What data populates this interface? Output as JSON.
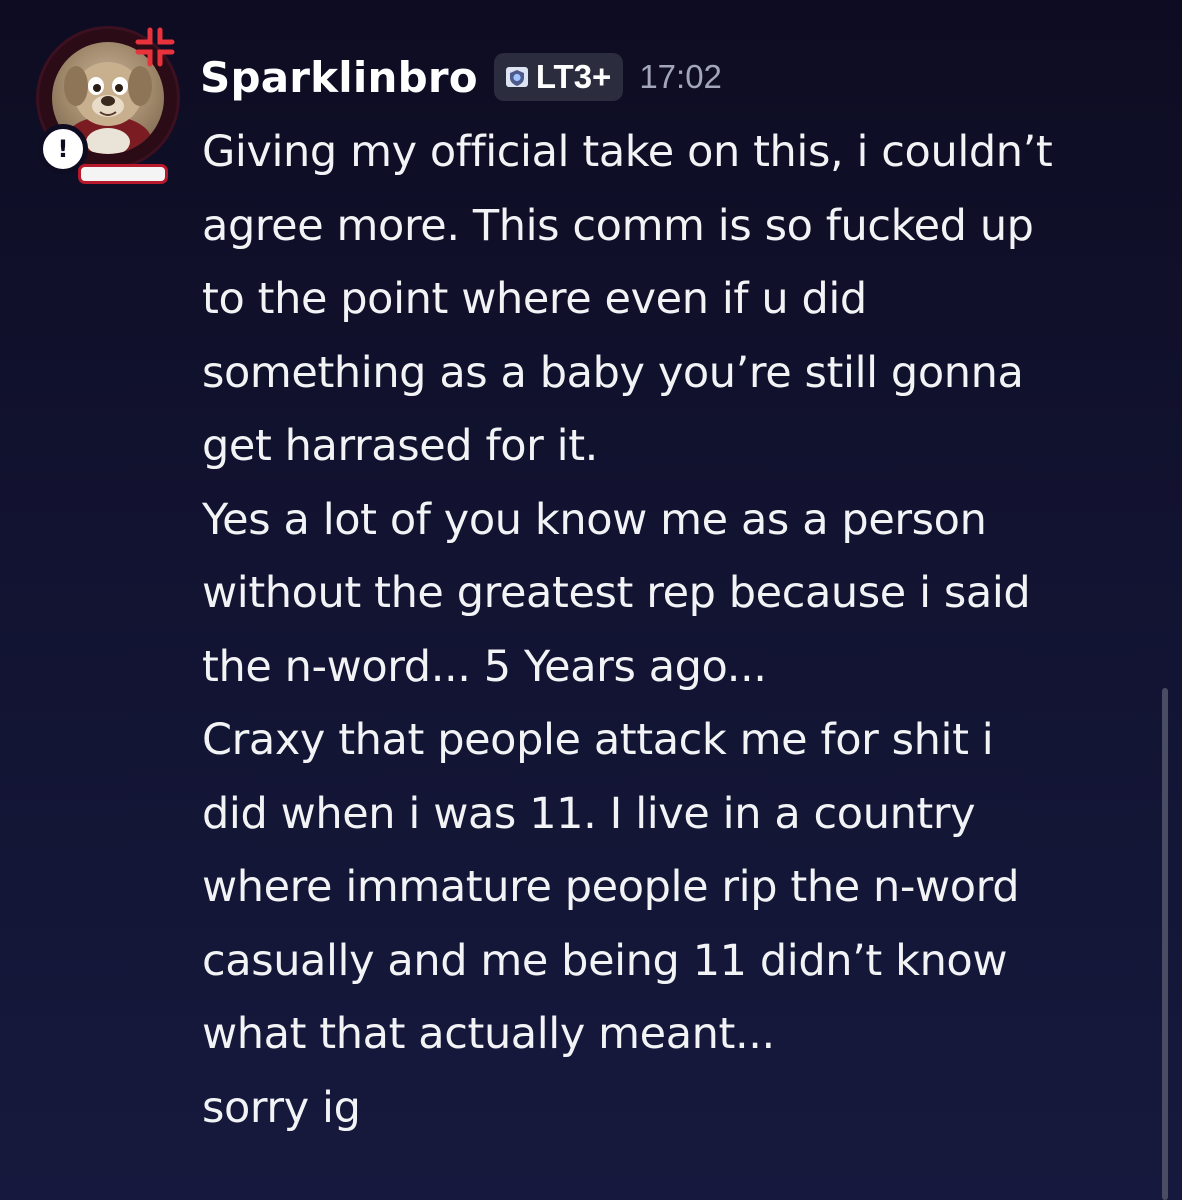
{
  "message": {
    "username": "Sparklinbro",
    "tag": {
      "label": "LT3+",
      "icon": "shield-badge-icon"
    },
    "timestamp": "17:02",
    "avatar": {
      "status_badge": "!",
      "overlay_icon": "angry-anger-symbol-icon"
    },
    "lines": [
      "Giving my official take on this, i couldn’t",
      "agree more. This comm is so fucked up",
      "to the point where even if u did",
      "something as a baby you’re still gonna",
      "get harrased for it.",
      "Yes a lot of you know me as a person",
      "without the greatest rep because i said",
      "the n-word... 5 Years ago...",
      "Craxy that people attack me for shit i",
      "did when i was 11. I live in a country",
      "where immature people rip the n-word",
      "casually and me being 11 didn’t know",
      "what that actually meant...",
      "sorry ig"
    ]
  },
  "colors": {
    "background": "#121331",
    "text": "#f2f3f5",
    "timestamp": "#a3a6b8",
    "tag_background": "#2b2c3d"
  }
}
